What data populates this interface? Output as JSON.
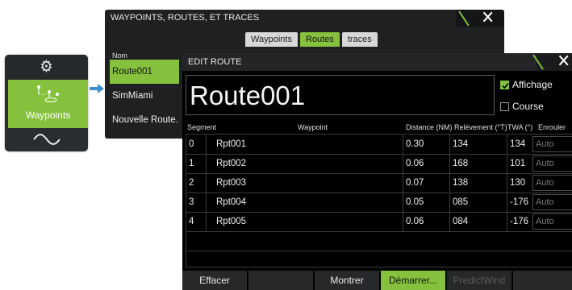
{
  "side_menu": {
    "gear_icon": "gear-icon",
    "waypoints_label": "Waypoints",
    "wave_icon": "wave-icon",
    "accent": "#86c13d"
  },
  "bg_window": {
    "title": "WAYPOINTS, ROUTES, ET TRACES",
    "tabs": [
      "Waypoints",
      "Routes",
      "traces"
    ],
    "active_tab": "Routes",
    "column_header": "Nom",
    "routes": [
      "Route001",
      "SimMiami",
      "Nouvelle Route..."
    ]
  },
  "dialog": {
    "title": "EDIT ROUTE",
    "route_name": "Route001",
    "checkboxes": [
      {
        "label": "Affichage",
        "checked": true
      },
      {
        "label": "Course",
        "checked": false
      }
    ],
    "headers": {
      "segment": "Segment",
      "waypoint": "Waypoint",
      "distance": "Distance (NM)",
      "bearing": "Relèvement (°T)",
      "twa": "TWA (°)",
      "enrouler": "Enrouler"
    },
    "rows": [
      {
        "segment": "0",
        "waypoint": "Rpt001",
        "distance": "0.30",
        "bearing": "134",
        "twa": "134",
        "enrouler": "Auto"
      },
      {
        "segment": "1",
        "waypoint": "Rpt002",
        "distance": "0.06",
        "bearing": "168",
        "twa": "101",
        "enrouler": "Auto"
      },
      {
        "segment": "2",
        "waypoint": "Rpt003",
        "distance": "0.07",
        "bearing": "138",
        "twa": "130",
        "enrouler": "Auto"
      },
      {
        "segment": "3",
        "waypoint": "Rpt004",
        "distance": "0.05",
        "bearing": "085",
        "twa": "-176",
        "enrouler": "Auto"
      },
      {
        "segment": "4",
        "waypoint": "Rpt005",
        "distance": "0.06",
        "bearing": "084",
        "twa": "-176",
        "enrouler": "Auto"
      }
    ],
    "buttons": {
      "effacer": "Effacer",
      "montrer": "Montrer",
      "demarrer": "Démarrer...",
      "predictwind": "PredictWind"
    }
  }
}
